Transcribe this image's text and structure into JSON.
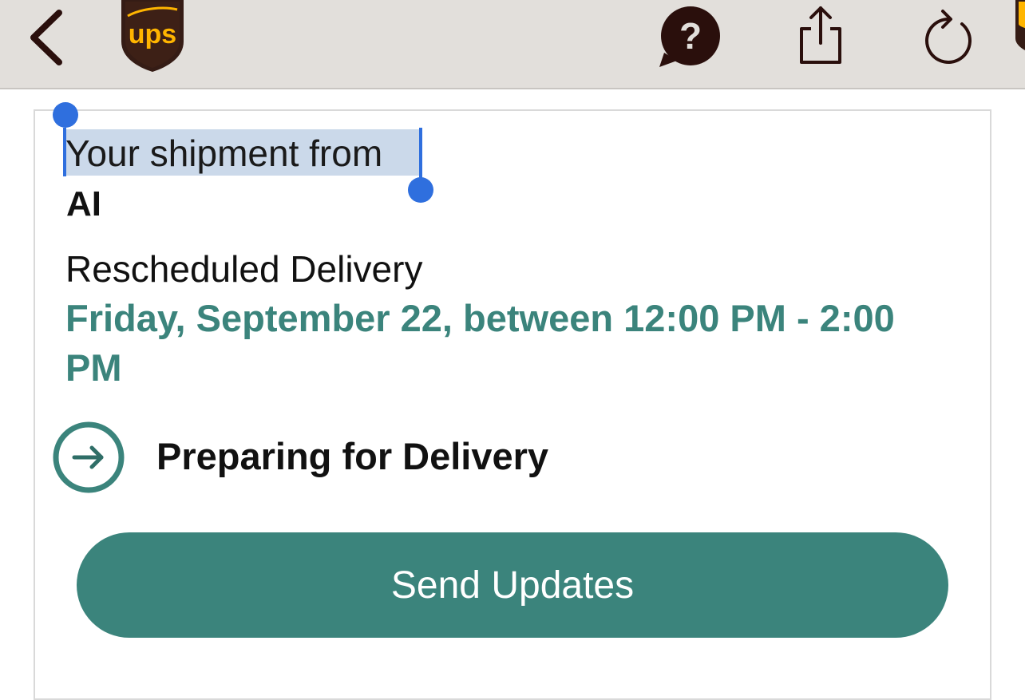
{
  "toolbar": {
    "back_icon": "chevron-left-icon",
    "logo_text": "UPS",
    "help_icon": "question-bubble-icon",
    "share_icon": "share-icon",
    "refresh_icon": "refresh-icon"
  },
  "shipment": {
    "heading": "Your shipment from",
    "sender": "AI",
    "status_label": "Rescheduled Delivery",
    "delivery_window": "Friday, September 22, between 12:00 PM - 2:00 PM",
    "progress_status": "Preparing for Delivery",
    "progress_icon": "arrow-right-circle-icon"
  },
  "actions": {
    "send_updates_label": "Send Updates"
  },
  "colors": {
    "brand_brown": "#351c15",
    "brand_gold": "#ffb500",
    "accent_teal": "#3b847c",
    "toolbar_bg": "#e2dfdb",
    "selection": "#2f6fde"
  }
}
